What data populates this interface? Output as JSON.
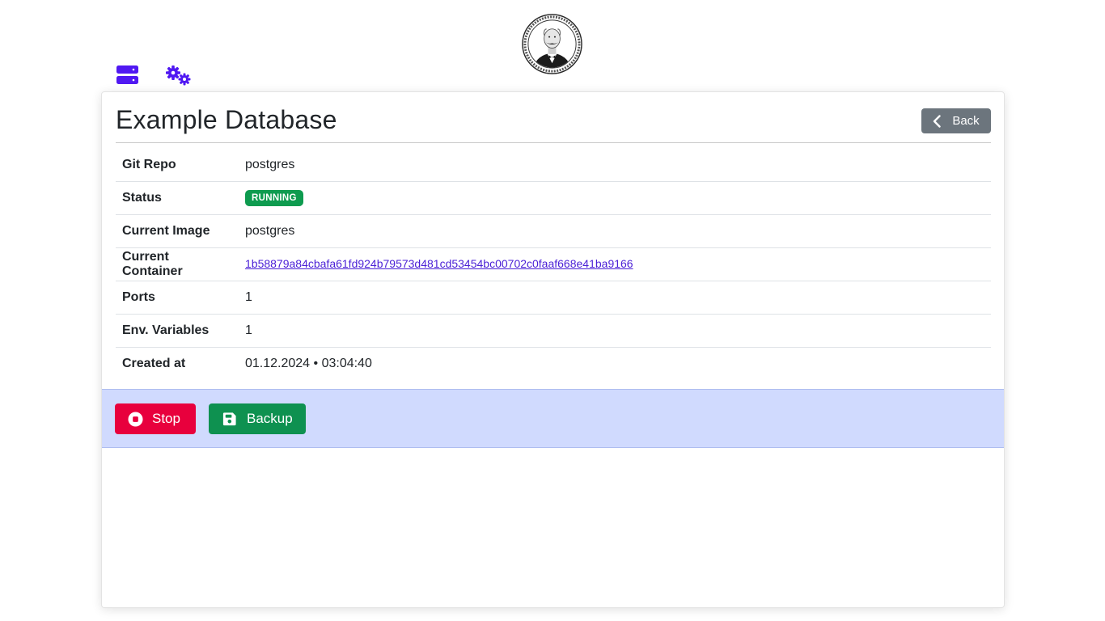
{
  "nav": {
    "icons": [
      "server-icon",
      "gears-icon"
    ]
  },
  "colors": {
    "accent": "#5018f2",
    "secondary": "#6c757d",
    "danger": "#e8003d",
    "success": "#0e9150",
    "action_bar": "#d0dafe"
  },
  "header": {
    "title": "Example Database",
    "back_label": "Back"
  },
  "details": {
    "git_repo": {
      "label": "Git Repo",
      "value": "postgres"
    },
    "status": {
      "label": "Status",
      "value": "RUNNING"
    },
    "current_image": {
      "label": "Current Image",
      "value": "postgres"
    },
    "current_container": {
      "label": "Current Container",
      "value": "1b58879a84cbafa61fd924b79573d481cd53454bc00702c0faaf668e41ba9166"
    },
    "ports": {
      "label": "Ports",
      "value": "1"
    },
    "env_variables": {
      "label": "Env. Variables",
      "value": "1"
    },
    "created_at": {
      "label": "Created at",
      "value": "01.12.2024 • 03:04:40"
    }
  },
  "actions": {
    "stop_label": "Stop",
    "backup_label": "Backup"
  }
}
